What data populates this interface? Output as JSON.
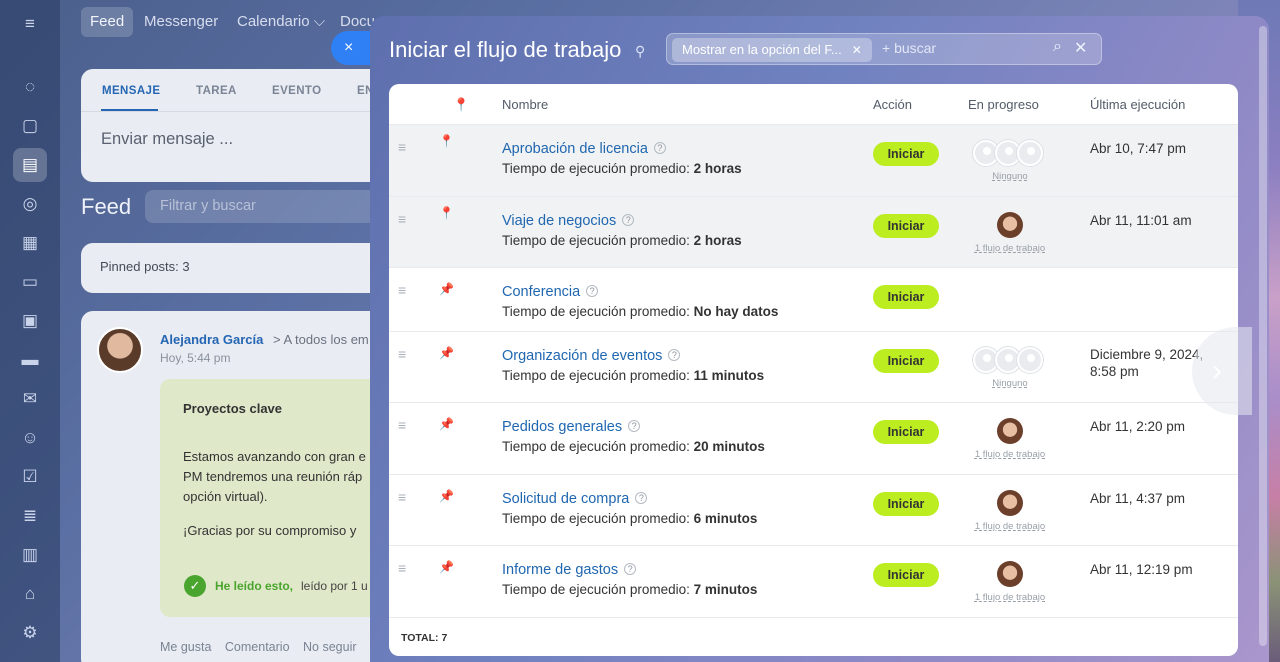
{
  "topnav": {
    "items": [
      "Feed",
      "Messenger",
      "Calendario ⌵",
      "Docu"
    ]
  },
  "composer": {
    "tabs": [
      "MENSAJE",
      "TAREA",
      "EVENTO",
      "EN"
    ],
    "placeholder": "Enviar mensaje ..."
  },
  "feed": {
    "title": "Feed",
    "filter_placeholder": "Filtrar y buscar",
    "pinned": "Pinned posts: 3",
    "post": {
      "author": "Alejandra García",
      "destination": "> A todos los em",
      "time": "Hoy, 5:44 pm",
      "title": "Proyectos clave",
      "lines": [
        "Estamos avanzando con gran e",
        "PM tendremos una reunión ráp",
        "opción virtual).",
        "¡Gracias por su compromiso y"
      ],
      "read_label": "He leído esto,",
      "read_by": "leído por 1 u",
      "actions": [
        "Me gusta",
        "Comentario",
        "No seguir"
      ]
    }
  },
  "slider": {
    "title": "Iniciar el flujo de trabajo",
    "filter_chip": "Mostrar en la opción del F...",
    "search_placeholder": "+ buscar"
  },
  "table": {
    "columns": {
      "name": "Nombre",
      "action": "Acción",
      "progress": "En progreso",
      "last_run": "Última ejecución"
    },
    "avg_prefix": "Tiempo de ejecución promedio:",
    "run_label": "Iniciar",
    "rows": [
      {
        "name": "Aprobación de licencia",
        "avg": "2 horas",
        "progress": "Ninguno",
        "last": "Abr 10, 7:47 pm"
      },
      {
        "name": "Viaje de negocios",
        "avg": "2 horas",
        "progress": "1 flujo de trabajo",
        "last": "Abr 11, 11:01 am"
      },
      {
        "name": "Conferencia",
        "avg": "No hay datos",
        "progress": "",
        "last": ""
      },
      {
        "name": "Organización de eventos",
        "avg": "11 minutos",
        "progress": "Ninguno",
        "last": "Diciembre 9, 2024, 8:58 pm"
      },
      {
        "name": "Pedidos generales",
        "avg": "20 minutos",
        "progress": "1 flujo de trabajo",
        "last": "Abr 11, 2:20 pm"
      },
      {
        "name": "Solicitud de compra",
        "avg": "6 minutos",
        "progress": "1 flujo de trabajo",
        "last": "Abr 11, 4:37 pm"
      },
      {
        "name": "Informe de gastos",
        "avg": "7 minutos",
        "progress": "1 flujo de trabajo",
        "last": "Abr 11, 12:19 pm"
      }
    ],
    "total_label": "TOTAL:",
    "total_value": "7"
  },
  "icons": {
    "close": "×",
    "pin": "📌",
    "search": "search-icon",
    "next": "›"
  },
  "colors": {
    "accent": "#2f7ff5",
    "run_button": "#bbed21",
    "link": "#2067b0"
  }
}
